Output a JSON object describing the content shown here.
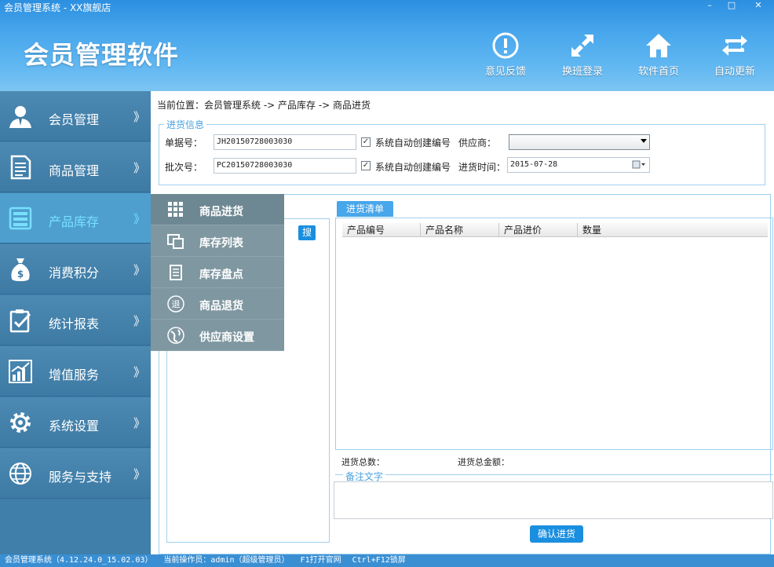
{
  "window": {
    "title": "会员管理系统 - XX旗舰店",
    "controls": {
      "minimize": "–",
      "maximize": "□",
      "close": "✕"
    }
  },
  "header": {
    "app_title": "会员管理软件",
    "buttons": [
      {
        "label": "意见反馈",
        "icon": "exclamation-circle-icon"
      },
      {
        "label": "换班登录",
        "icon": "expand-arrows-icon"
      },
      {
        "label": "软件首页",
        "icon": "home-icon"
      },
      {
        "label": "自动更新",
        "icon": "refresh-icon"
      }
    ]
  },
  "sidebar": {
    "arrow": "》",
    "items": [
      {
        "label": "会员管理",
        "icon": "user-icon"
      },
      {
        "label": "商品管理",
        "icon": "document-icon"
      },
      {
        "label": "产品库存",
        "icon": "cabinet-icon",
        "active": true
      },
      {
        "label": "消费积分",
        "icon": "money-bag-icon"
      },
      {
        "label": "统计报表",
        "icon": "clipboard-check-icon"
      },
      {
        "label": "增值服务",
        "icon": "chart-up-icon"
      },
      {
        "label": "系统设置",
        "icon": "gear-icon"
      },
      {
        "label": "服务与支持",
        "icon": "globe-icon"
      }
    ]
  },
  "submenu": {
    "items": [
      {
        "label": "商品进货",
        "icon": "grid-icon",
        "active": true
      },
      {
        "label": "库存列表",
        "icon": "windows-icon"
      },
      {
        "label": "库存盘点",
        "icon": "scroll-icon"
      },
      {
        "label": "商品退货",
        "icon": "return-circle-icon"
      },
      {
        "label": "供应商设置",
        "icon": "globe-swirl-icon"
      }
    ]
  },
  "main": {
    "breadcrumb": "当前位置：会员管理系统 -> 产品库存 -> 商品进货",
    "info": {
      "legend": "进货信息",
      "order_no_label": "单据号：",
      "order_no_value": "JH20150728003030",
      "batch_no_label": "批次号：",
      "batch_no_value": "PC20150728003030",
      "auto_create_label": "系统自动创建编号",
      "auto_create_checked": "✓",
      "supplier_label": "供应商：",
      "supplier_value": "",
      "time_label": "进货时间：",
      "time_value": "2015-07-28"
    },
    "search_button": "搜",
    "tab_label": "进货清单",
    "grid": {
      "columns": [
        "产品编号",
        "产品名称",
        "产品进价",
        "数量"
      ]
    },
    "totals": {
      "qty_label": "进货总数：",
      "amount_label": "进货总金额："
    },
    "note_legend": "备注文字",
    "confirm_button": "确认进货"
  },
  "statusbar": {
    "version": "会员管理系统（4.12.24.0_15.02.03）",
    "operator": "当前操作员：admin（超级管理员）",
    "hotkey1": "F1打开官网",
    "hotkey2": "Ctrl+F12锁屏"
  },
  "colors": {
    "header_blue": "#3c9ee6",
    "sidebar": "#3f7fa9",
    "active_item_text": "#78e0ff",
    "accent_button": "#1a8fe0"
  }
}
